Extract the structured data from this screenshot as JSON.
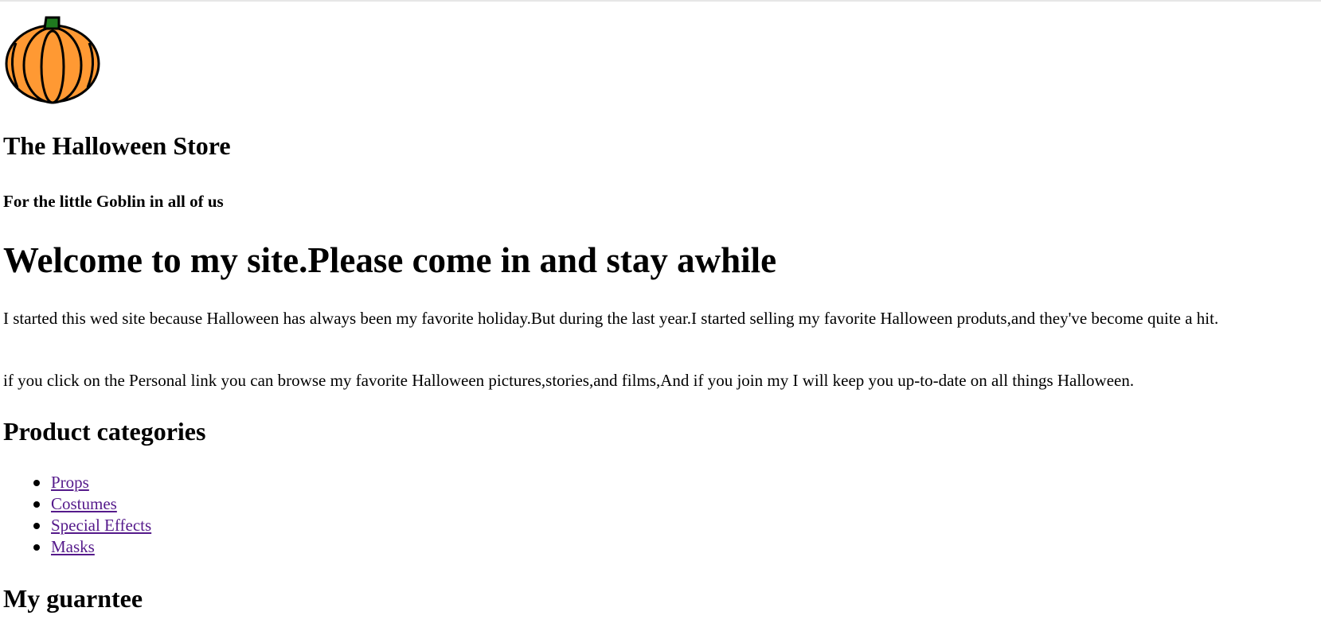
{
  "logo": {
    "icon": "pumpkin-icon",
    "colors": {
      "body": "#ff9933",
      "stem": "#1f7a1f",
      "outline": "#000000"
    }
  },
  "header": {
    "title": "The Halloween Store",
    "tagline": "For the little Goblin in all of us"
  },
  "main": {
    "welcome": "Welcome to my site.Please come in and stay awhile",
    "paragraphs": [
      "I started this wed site because Halloween has always been my favorite holiday.But during the last year.I started selling my favorite Halloween produts,and they've become quite a hit.",
      "if you click on the Personal link you can browse my favorite Halloween pictures,stories,and films,And if you join my I will keep you up-to-date on all things Halloween."
    ],
    "categories_title": "Product categories",
    "categories": [
      "Props",
      "Costumes",
      "Special Effects",
      "Masks"
    ],
    "guarantee_title": "My guarntee"
  },
  "colors": {
    "link_visited": "#551a8b",
    "text": "#000000",
    "background": "#ffffff"
  }
}
